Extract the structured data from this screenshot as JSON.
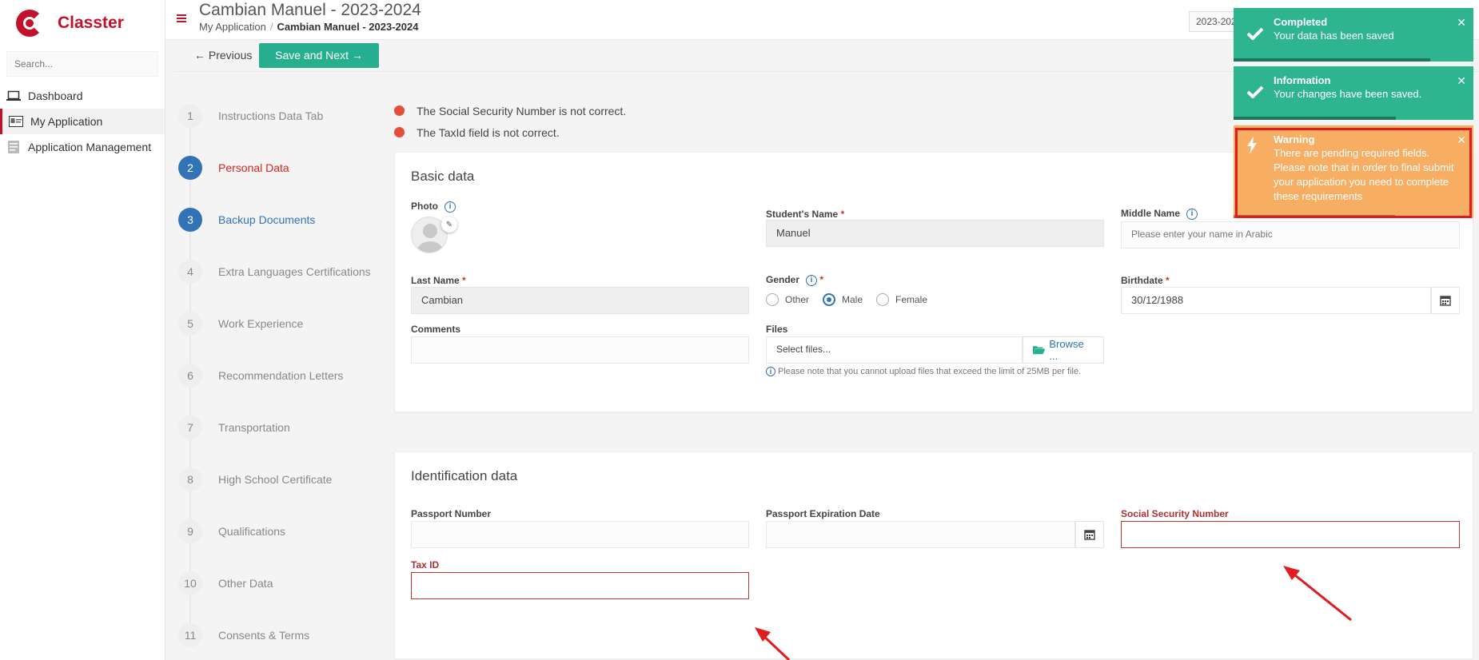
{
  "app": {
    "name": "Classter"
  },
  "sidebar": {
    "search_placeholder": "Search...",
    "items": [
      {
        "label": "Dashboard",
        "icon": "laptop-icon"
      },
      {
        "label": "My Application",
        "icon": "id-card-icon"
      },
      {
        "label": "Application Management",
        "icon": "form-icon"
      }
    ]
  },
  "header": {
    "title": "Cambian Manuel - 2023-2024",
    "breadcrumb": [
      "My Application",
      "Cambian Manuel - 2023-2024"
    ],
    "year_select": "2023-2024"
  },
  "toolbar": {
    "prev_label": "← Previous",
    "next_label": "Save and Next →"
  },
  "steps": [
    {
      "num": "1",
      "label": "Instructions Data Tab"
    },
    {
      "num": "2",
      "label": "Personal Data"
    },
    {
      "num": "3",
      "label": "Backup Documents"
    },
    {
      "num": "4",
      "label": "Extra Languages Certifications"
    },
    {
      "num": "5",
      "label": "Work Experience"
    },
    {
      "num": "6",
      "label": "Recommendation Letters"
    },
    {
      "num": "7",
      "label": "Transportation"
    },
    {
      "num": "8",
      "label": "High School Certificate"
    },
    {
      "num": "9",
      "label": "Qualifications"
    },
    {
      "num": "10",
      "label": "Other Data"
    },
    {
      "num": "11",
      "label": "Consents & Terms"
    }
  ],
  "errors": [
    "The Social Security Number is not correct.",
    "The TaxId field is not correct."
  ],
  "basic": {
    "title": "Basic data",
    "photo_label": "Photo",
    "student_name_label": "Student's Name",
    "student_name_value": "Manuel",
    "middle_name_label": "Middle Name",
    "middle_name_placeholder": "Please enter your name in Arabic",
    "last_name_label": "Last Name",
    "last_name_value": "Cambian",
    "gender_label": "Gender",
    "gender_options": [
      "Other",
      "Male",
      "Female"
    ],
    "birthdate_label": "Birthdate",
    "birthdate_value": "30/12/1988",
    "comments_label": "Comments",
    "files_label": "Files",
    "files_placeholder": "Select files...",
    "browse_label": "Browse ...",
    "files_hint": "Please note that you cannot upload files that exceed the limit of 25MB per file."
  },
  "identification": {
    "title": "Identification data",
    "passport_number_label": "Passport Number",
    "passport_expiration_label": "Passport Expiration Date",
    "ssn_label": "Social Security Number",
    "tax_id_label": "Tax ID"
  },
  "toasts": [
    {
      "title": "Completed",
      "message": "Your data has been saved"
    },
    {
      "title": "Information",
      "message": "Your changes have been saved."
    },
    {
      "title": "Warning",
      "message": "There are pending required fields. Please note that in order to final submit your application you need to complete these requirements"
    }
  ],
  "colors": {
    "brand": "#c2122b",
    "accent": "#27ae8f",
    "primary": "#3173b4",
    "error": "#c0392b",
    "warning": "#f7ae63"
  }
}
